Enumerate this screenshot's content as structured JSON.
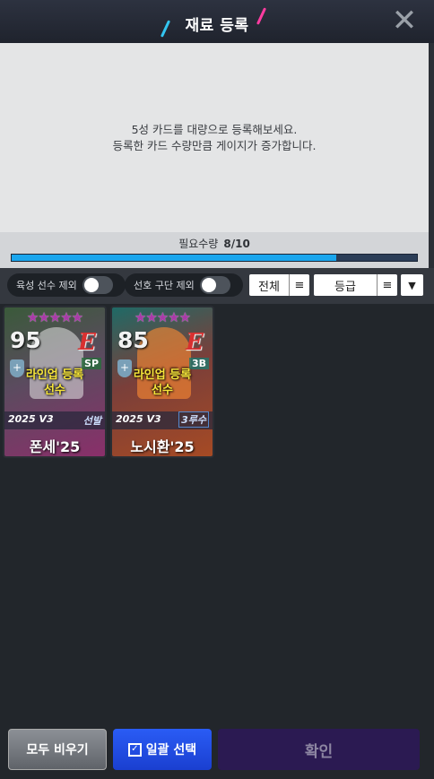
{
  "header": {
    "title": "재료 등록",
    "close_icon": "✕"
  },
  "info": {
    "line1": "5성 카드를 대량으로 등록해보세요.",
    "line2": "등록한 카드 수량만큼 게이지가 증가합니다."
  },
  "progress": {
    "label": "필요수량",
    "count": "8/10",
    "value": 0.8
  },
  "filters": {
    "toggle1_label": "육성 선수 제외",
    "toggle2_label": "선호 구단 제외",
    "dropdown1_label": "전체",
    "dropdown2_label": "등급",
    "menu_icon": "≡",
    "sort_icon": "▼"
  },
  "cards": [
    {
      "stars": "★★★★★",
      "rating": "95",
      "team_logo": "E",
      "position_badge": "SP",
      "overlay_line1": "라인업 등록",
      "overlay_line2": "선수",
      "edition": "2025 V3",
      "edition_tag": "선발",
      "name": "폰세'25"
    },
    {
      "stars": "★★★★★",
      "rating": "85",
      "team_logo": "E",
      "position_badge": "3B",
      "overlay_line1": "라인업 등록",
      "overlay_line2": "선수",
      "edition": "2025 V3",
      "edition_tag": "3루수",
      "name": "노시환'25"
    }
  ],
  "footer": {
    "clear_label": "모두 비우기",
    "select_label": "일괄 선택",
    "confirm_label": "확인"
  }
}
